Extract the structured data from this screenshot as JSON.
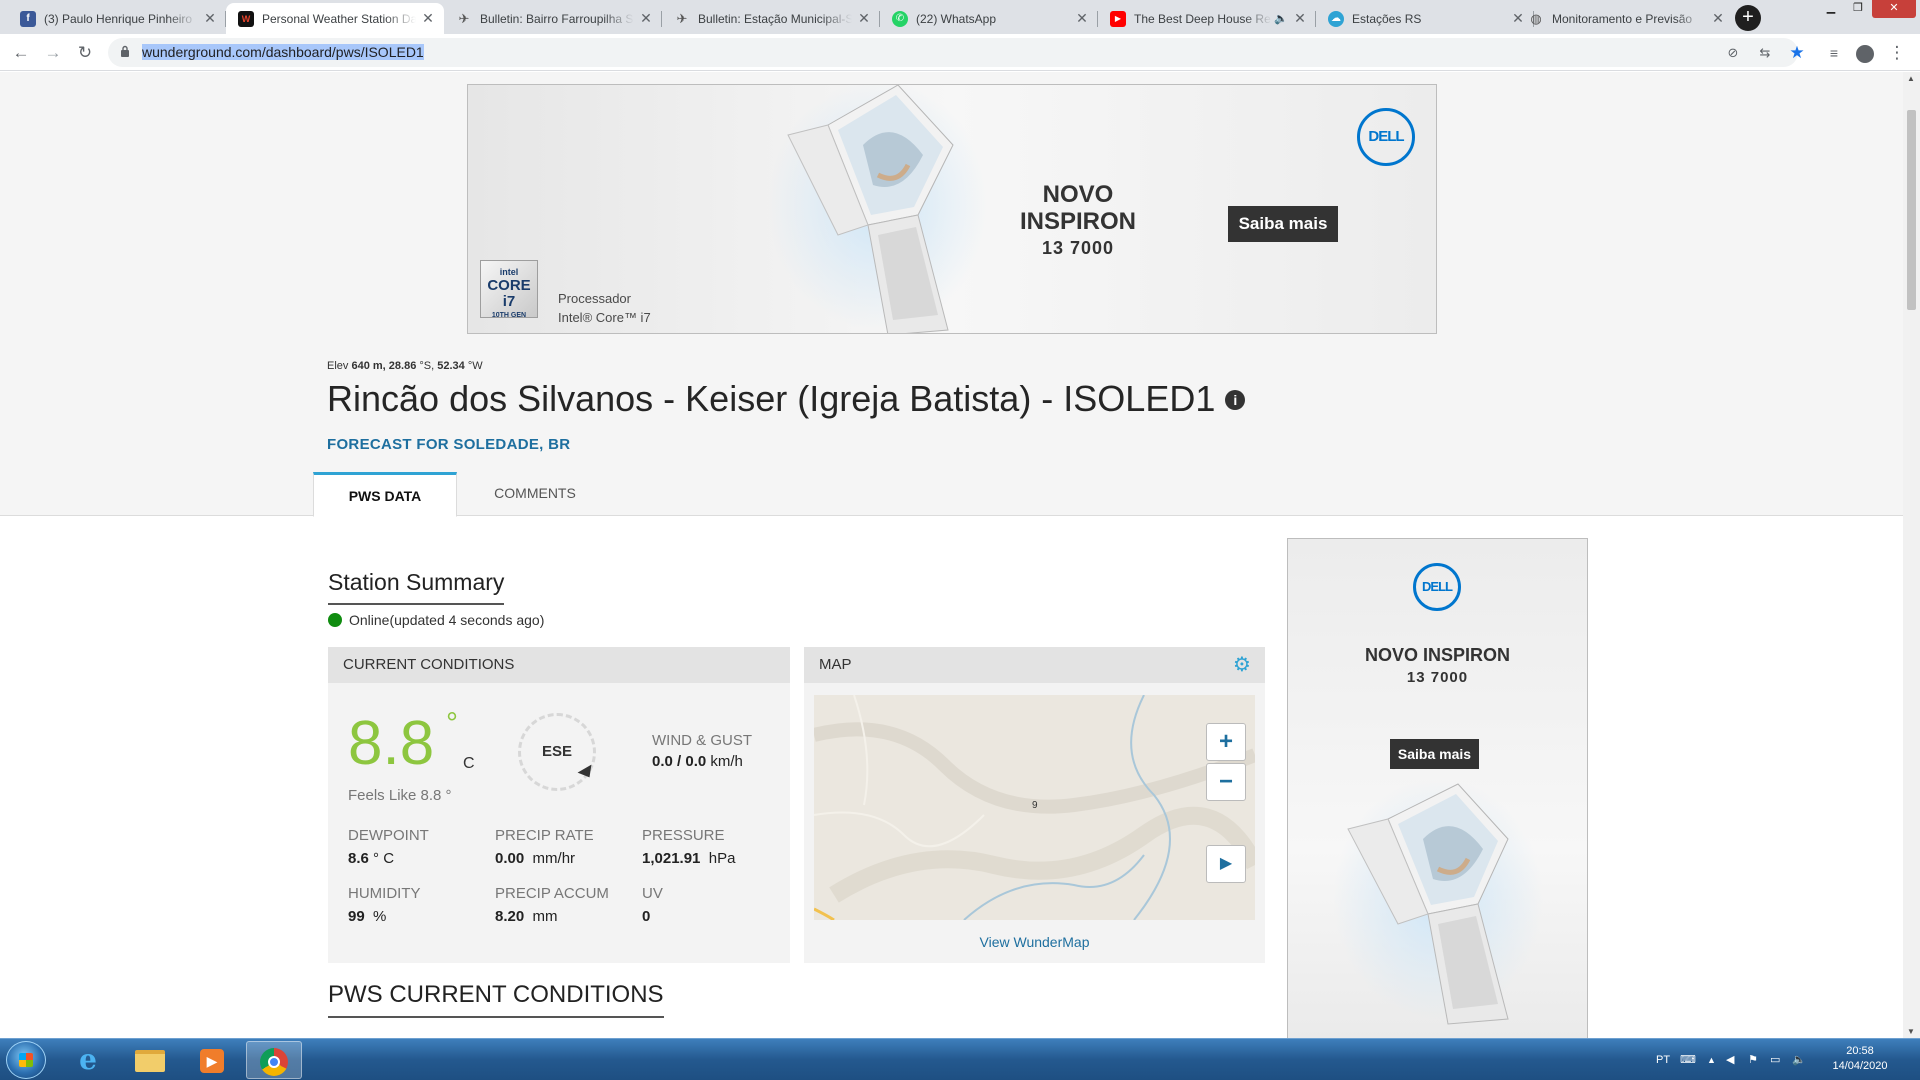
{
  "browser": {
    "tabs": [
      {
        "title": "(3) Paulo Henrique Pinheiro",
        "icon": "facebook-icon",
        "color": "#3b5998"
      },
      {
        "title": "Personal Weather Station Da",
        "icon": "wunderground-icon",
        "color": "#111111",
        "active": true
      },
      {
        "title": "Bulletin: Bairro Farroupilha S",
        "icon": "plane-icon",
        "color": "#555555"
      },
      {
        "title": "Bulletin: Estação Municipal-S",
        "icon": "plane-icon",
        "color": "#555555"
      },
      {
        "title": "(22) WhatsApp",
        "icon": "whatsapp-icon",
        "color": "#25d366"
      },
      {
        "title": "The Best Deep House Re",
        "icon": "youtube-icon",
        "color": "#ff0000"
      },
      {
        "title": "Estações RS",
        "icon": "cloud-icon",
        "color": "#2fa3d4"
      },
      {
        "title": "Monitoramento e Previsão",
        "icon": "globe-icon",
        "color": "#555555"
      }
    ],
    "url": "wunderground.com/dashboard/pws/ISOLED1"
  },
  "ads": {
    "banner": {
      "title_line1": "NOVO",
      "title_line2": "INSPIRON",
      "model": "13 7000",
      "cta": "Saiba mais",
      "processor_line1": "Processador",
      "processor_line2": "Intel® Core™ i7",
      "brand": "DELL",
      "intel_badge_top": "intel",
      "intel_badge_mid": "CORE i7",
      "intel_badge_bot": "10TH GEN"
    },
    "side": {
      "title": "NOVO INSPIRON",
      "model": "13 7000",
      "cta": "Saiba mais",
      "brand": "DELL"
    }
  },
  "station": {
    "elev_prefix": "Elev",
    "elev_value": "640 m,",
    "lat": "28.86",
    "lat_unit": "°S,",
    "lon": "52.34",
    "lon_unit": "°W",
    "title": "Rincão dos Silvanos - Keiser (Igreja Batista) - ISOLED1",
    "forecast_link": "FORECAST FOR SOLEDADE, BR"
  },
  "page_tabs": [
    {
      "label": "PWS DATA",
      "active": true
    },
    {
      "label": "COMMENTS",
      "active": false
    }
  ],
  "summary": {
    "title": "Station Summary",
    "status": "Online(updated 4 seconds ago)",
    "status_color": "#108c10"
  },
  "current": {
    "header": "CURRENT CONDITIONS",
    "temp": "8.8",
    "deg_symbol": "°",
    "temp_unit": "C",
    "feels_like": "Feels Like 8.8 °",
    "wind_dir": "ESE",
    "wind_label": "WIND & GUST",
    "wind_speed": "0.0",
    "wind_gust": "/ 0.0",
    "wind_unit": "km/h",
    "metrics": [
      {
        "label": "DEWPOINT",
        "value": "8.6",
        "unit": "° C"
      },
      {
        "label": "PRECIP RATE",
        "value": "0.00",
        "unit": "mm/hr"
      },
      {
        "label": "PRESSURE",
        "value": "1,021.91",
        "unit": "hPa"
      },
      {
        "label": "HUMIDITY",
        "value": "99",
        "unit": "%"
      },
      {
        "label": "PRECIP ACCUM",
        "value": "8.20",
        "unit": "mm"
      },
      {
        "label": "UV",
        "value": "0",
        "unit": ""
      }
    ],
    "accent_color": "#8dc63f"
  },
  "map": {
    "header": "MAP",
    "marker_label": "9",
    "zoom_in": "+",
    "zoom_out": "−",
    "play": "▶",
    "link": "View WunderMap"
  },
  "pws_conditions": {
    "title": "PWS CURRENT CONDITIONS"
  },
  "taskbar": {
    "lang": "PT",
    "time": "20:58",
    "date": "14/04/2020"
  }
}
